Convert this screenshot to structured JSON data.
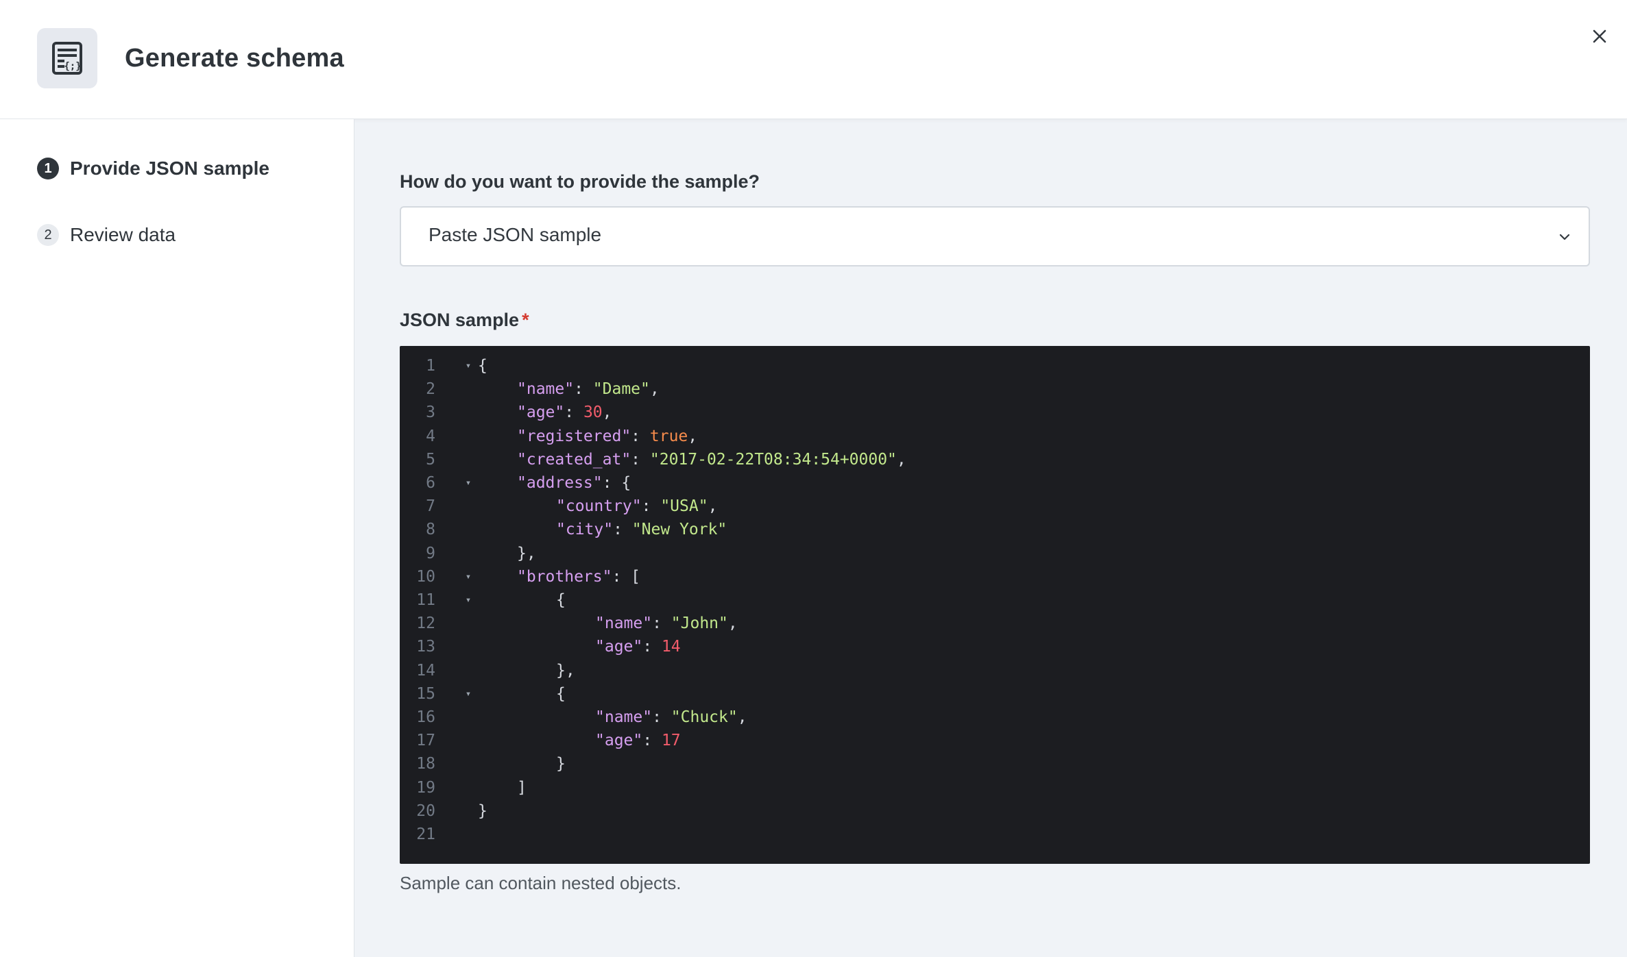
{
  "header": {
    "title": "Generate schema",
    "icon": "schema-document-icon"
  },
  "steps": [
    {
      "num": "1",
      "label": "Provide JSON sample",
      "active": true
    },
    {
      "num": "2",
      "label": "Review data",
      "active": false
    }
  ],
  "form": {
    "method_label": "How do you want to provide the sample?",
    "method_value": "Paste JSON sample",
    "sample_label": "JSON sample",
    "required_mark": "*",
    "help_text": "Sample can contain nested objects."
  },
  "editor": {
    "lines": [
      {
        "n": "1",
        "fold": true,
        "indent": 0,
        "tokens": [
          [
            "p",
            "{"
          ]
        ]
      },
      {
        "n": "2",
        "fold": false,
        "indent": 1,
        "tokens": [
          [
            "k",
            "\"name\""
          ],
          [
            "p",
            ": "
          ],
          [
            "s",
            "\"Dame\""
          ],
          [
            "p",
            ","
          ]
        ]
      },
      {
        "n": "3",
        "fold": false,
        "indent": 1,
        "tokens": [
          [
            "k",
            "\"age\""
          ],
          [
            "p",
            ": "
          ],
          [
            "n",
            "30"
          ],
          [
            "p",
            ","
          ]
        ]
      },
      {
        "n": "4",
        "fold": false,
        "indent": 1,
        "tokens": [
          [
            "k",
            "\"registered\""
          ],
          [
            "p",
            ": "
          ],
          [
            "b",
            "true"
          ],
          [
            "p",
            ","
          ]
        ]
      },
      {
        "n": "5",
        "fold": false,
        "indent": 1,
        "tokens": [
          [
            "k",
            "\"created_at\""
          ],
          [
            "p",
            ": "
          ],
          [
            "s",
            "\"2017-02-22T08:34:54+0000\""
          ],
          [
            "p",
            ","
          ]
        ]
      },
      {
        "n": "6",
        "fold": true,
        "indent": 1,
        "tokens": [
          [
            "k",
            "\"address\""
          ],
          [
            "p",
            ": {"
          ]
        ]
      },
      {
        "n": "7",
        "fold": false,
        "indent": 2,
        "tokens": [
          [
            "k",
            "\"country\""
          ],
          [
            "p",
            ": "
          ],
          [
            "s",
            "\"USA\""
          ],
          [
            "p",
            ","
          ]
        ]
      },
      {
        "n": "8",
        "fold": false,
        "indent": 2,
        "tokens": [
          [
            "k",
            "\"city\""
          ],
          [
            "p",
            ": "
          ],
          [
            "s",
            "\"New York\""
          ]
        ]
      },
      {
        "n": "9",
        "fold": false,
        "indent": 1,
        "tokens": [
          [
            "p",
            "},"
          ]
        ]
      },
      {
        "n": "10",
        "fold": true,
        "indent": 1,
        "tokens": [
          [
            "k",
            "\"brothers\""
          ],
          [
            "p",
            ": ["
          ]
        ]
      },
      {
        "n": "11",
        "fold": true,
        "indent": 2,
        "tokens": [
          [
            "p",
            "{"
          ]
        ]
      },
      {
        "n": "12",
        "fold": false,
        "indent": 3,
        "tokens": [
          [
            "k",
            "\"name\""
          ],
          [
            "p",
            ": "
          ],
          [
            "s",
            "\"John\""
          ],
          [
            "p",
            ","
          ]
        ]
      },
      {
        "n": "13",
        "fold": false,
        "indent": 3,
        "tokens": [
          [
            "k",
            "\"age\""
          ],
          [
            "p",
            ": "
          ],
          [
            "n",
            "14"
          ]
        ]
      },
      {
        "n": "14",
        "fold": false,
        "indent": 2,
        "tokens": [
          [
            "p",
            "},"
          ]
        ]
      },
      {
        "n": "15",
        "fold": true,
        "indent": 2,
        "tokens": [
          [
            "p",
            "{"
          ]
        ]
      },
      {
        "n": "16",
        "fold": false,
        "indent": 3,
        "tokens": [
          [
            "k",
            "\"name\""
          ],
          [
            "p",
            ": "
          ],
          [
            "s",
            "\"Chuck\""
          ],
          [
            "p",
            ","
          ]
        ]
      },
      {
        "n": "17",
        "fold": false,
        "indent": 3,
        "tokens": [
          [
            "k",
            "\"age\""
          ],
          [
            "p",
            ": "
          ],
          [
            "n",
            "17"
          ]
        ]
      },
      {
        "n": "18",
        "fold": false,
        "indent": 2,
        "tokens": [
          [
            "p",
            "}"
          ]
        ]
      },
      {
        "n": "19",
        "fold": false,
        "indent": 1,
        "tokens": [
          [
            "p",
            "]"
          ]
        ]
      },
      {
        "n": "20",
        "fold": false,
        "indent": 0,
        "tokens": [
          [
            "p",
            "}"
          ]
        ]
      },
      {
        "n": "21",
        "fold": false,
        "indent": 0,
        "tokens": []
      }
    ]
  }
}
